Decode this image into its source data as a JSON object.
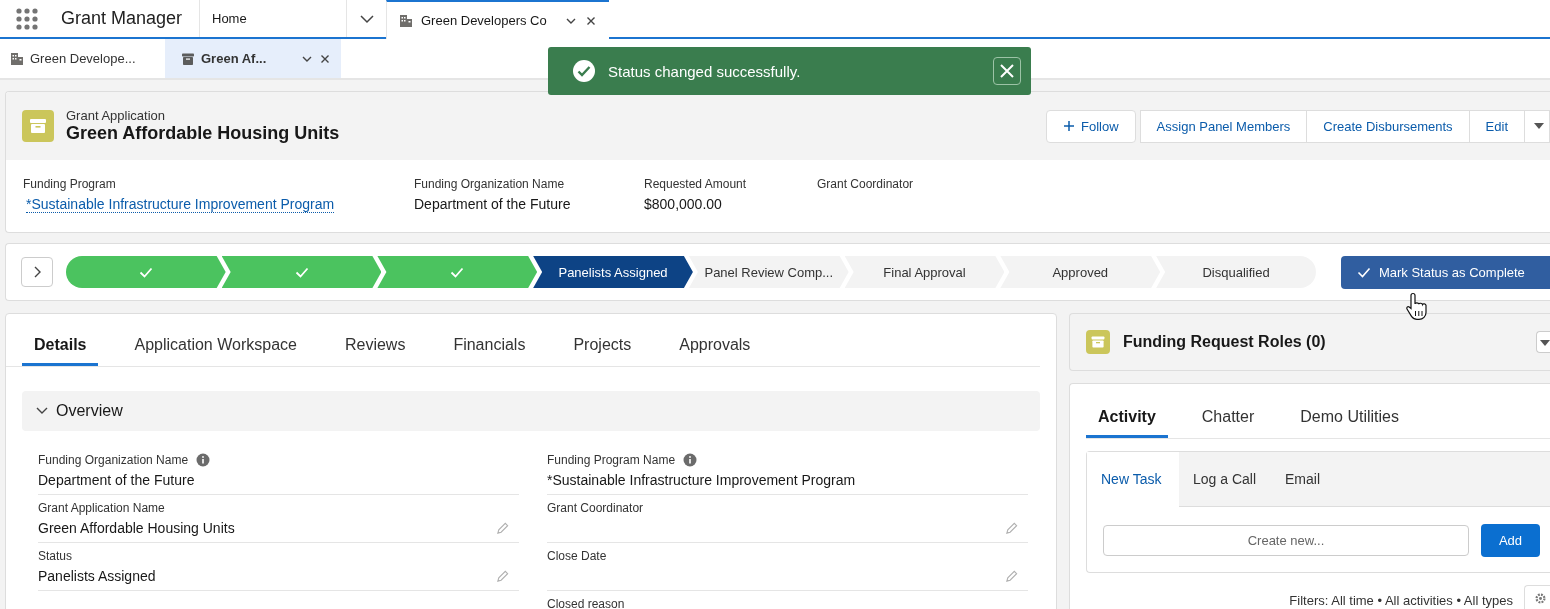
{
  "app": {
    "name": "Grant Manager"
  },
  "nav_tabs": [
    {
      "label": "Home",
      "selected": false,
      "kind": "home"
    },
    {
      "label": "Green Developers Co",
      "selected": true,
      "kind": "record"
    }
  ],
  "sub_tabs": [
    {
      "label": "Green Develope...",
      "selected": false,
      "kind": "account"
    },
    {
      "label": "Green Af...",
      "selected": true,
      "kind": "application"
    }
  ],
  "toast": {
    "message": "Status changed successfully."
  },
  "record": {
    "object": "Grant Application",
    "title": "Green Affordable Housing Units",
    "actions": [
      {
        "label": "Follow",
        "kind": "follow"
      },
      {
        "label": "Assign Panel Members",
        "kind": "plain"
      },
      {
        "label": "Create Disbursements",
        "kind": "plain"
      },
      {
        "label": "Edit",
        "kind": "plain"
      }
    ],
    "highlights": [
      {
        "label": "Funding Program",
        "value": "*Sustainable Infrastructure Improvement Program",
        "kind": "link"
      },
      {
        "label": "Funding Organization Name",
        "value": "Department of the Future",
        "kind": "text"
      },
      {
        "label": "Requested Amount",
        "value": "$800,000.00",
        "kind": "text"
      },
      {
        "label": "Grant Coordinator"
      }
    ]
  },
  "path": {
    "stages": [
      {
        "completed": true,
        "selected": false
      },
      {
        "completed": true,
        "selected": false
      },
      {
        "completed": true,
        "selected": false
      },
      {
        "label": "Panelists Assigned",
        "completed": false,
        "selected": true
      },
      {
        "label": "Panel Review Comp...",
        "completed": false,
        "selected": false
      },
      {
        "label": "Final Approval",
        "completed": false,
        "selected": false
      },
      {
        "label": "Approved",
        "completed": false,
        "selected": false
      },
      {
        "label": "Disqualified",
        "completed": false,
        "selected": false
      }
    ],
    "button": "Mark Status as Complete"
  },
  "detail_tabs": [
    {
      "label": "Details",
      "selected": true
    },
    {
      "label": "Application Workspace",
      "selected": false
    },
    {
      "label": "Reviews",
      "selected": false
    },
    {
      "label": "Financials",
      "selected": false
    },
    {
      "label": "Projects",
      "selected": false
    },
    {
      "label": "Approvals",
      "selected": false
    }
  ],
  "section": {
    "title": "Overview",
    "expanded": true
  },
  "left_fields": [
    {
      "label": "Funding Organization Name",
      "value": "Department of the Future",
      "info": true,
      "editable": false
    },
    {
      "label": "Grant Application Name",
      "value": "Green Affordable Housing Units",
      "info": false,
      "editable": true
    },
    {
      "label": "Status",
      "value": "Panelists Assigned",
      "info": false,
      "editable": true
    }
  ],
  "right_fields": [
    {
      "label": "Funding Program Name",
      "value": "*Sustainable Infrastructure Improvement Program",
      "info": true,
      "editable": false
    },
    {
      "label": "Grant Coordinator",
      "info": false,
      "editable": true
    },
    {
      "label": "Close Date",
      "info": false,
      "editable": true
    },
    {
      "label": "Closed reason",
      "info": false
    }
  ],
  "related": {
    "title": "Funding Request Roles (0)"
  },
  "activity": {
    "tabs": [
      {
        "label": "Activity",
        "selected": true
      },
      {
        "label": "Chatter",
        "selected": false
      },
      {
        "label": "Demo Utilities",
        "selected": false
      }
    ],
    "composer_tabs": [
      {
        "label": "New Task",
        "selected": true
      },
      {
        "label": "Log a Call",
        "selected": false
      },
      {
        "label": "Email",
        "selected": false
      }
    ],
    "placeholder": "Create new...",
    "button": "Add",
    "filters": "Filters: All time • All activities • All types"
  }
}
